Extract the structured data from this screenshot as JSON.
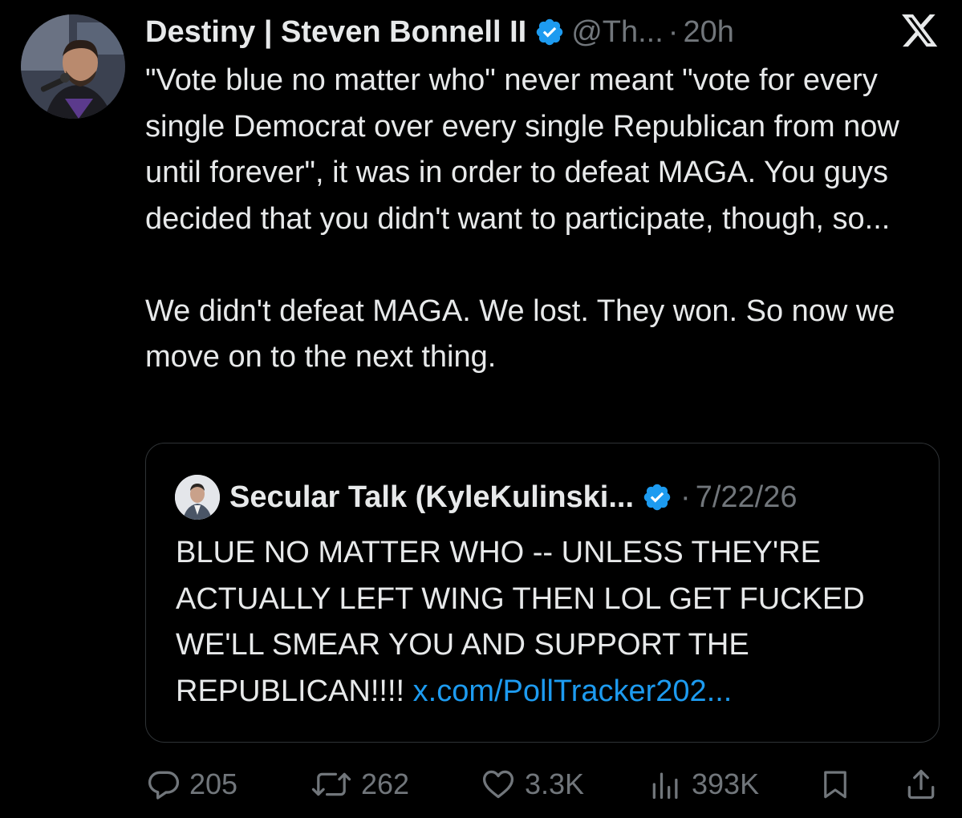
{
  "tweet": {
    "author_name": "Destiny | Steven Bonnell II",
    "handle": "@Th...",
    "separator": "·",
    "time": "20h",
    "text": "\"Vote blue no matter who\" never meant \"vote for every single Democrat over every single Republican from now until forever\", it was in order to defeat MAGA. You guys decided that you didn't want to participate, though, so...\n\nWe didn't defeat MAGA. We lost. They won. So now we move on to the next thing."
  },
  "quote": {
    "author_name": "Secular Talk (KyleKulinski...",
    "separator": "·",
    "date": "7/22/26",
    "text": "BLUE NO MATTER WHO -- UNLESS THEY'RE ACTUALLY LEFT WING THEN LOL GET FUCKED WE'LL SMEAR YOU AND SUPPORT THE REPUBLICAN!!!!",
    "link": "x.com/PollTracker202..."
  },
  "actions": {
    "replies": "205",
    "reposts": "262",
    "likes": "3.3K",
    "views": "393K"
  },
  "icons": {
    "verified": "verified-badge-icon",
    "platform": "x-logo-icon",
    "reply": "reply-icon",
    "repost": "repost-icon",
    "like": "heart-icon",
    "views": "views-icon",
    "bookmark": "bookmark-icon",
    "share": "share-icon"
  },
  "colors": {
    "background": "#000000",
    "text": "#e7e9ea",
    "secondary": "#71767b",
    "link": "#1d9bf0",
    "verified": "#1d9bf0",
    "border": "#2f3336"
  }
}
